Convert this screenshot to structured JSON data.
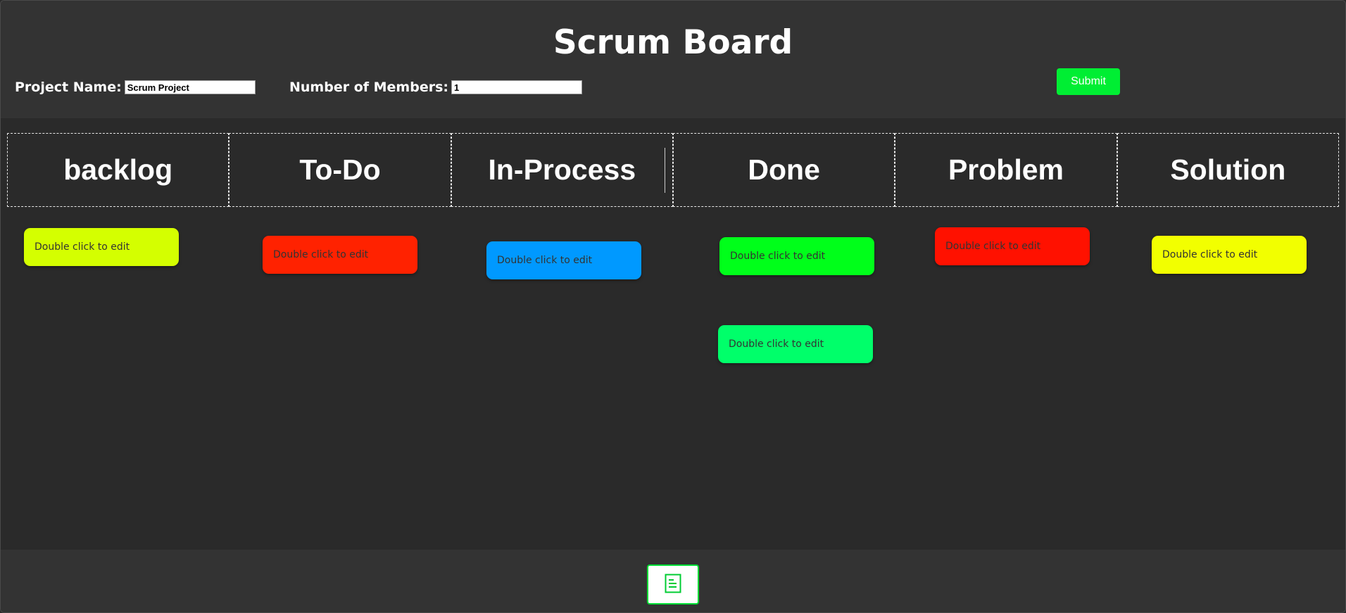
{
  "header": {
    "title": "Scrum Board",
    "project_name_label": "Project Name:",
    "project_name_value": "Scrum Project",
    "members_label": "Number of Members:",
    "members_value": "1",
    "submit_label": "Submit"
  },
  "columns": [
    "backlog",
    "To-Do",
    "In-Process",
    "Done",
    "Problem",
    "Solution"
  ],
  "notes": [
    {
      "column": "backlog",
      "text": "Double click to edit",
      "color": "#d4ff00"
    },
    {
      "column": "To-Do",
      "text": "Double click to edit",
      "color": "#ff2200"
    },
    {
      "column": "In-Process",
      "text": "Double click to edit",
      "color": "#0099ff"
    },
    {
      "column": "Done",
      "text": "Double click to edit",
      "color": "#00ff1a"
    },
    {
      "column": "Done",
      "text": "Double click to edit",
      "color": "#00ff6a"
    },
    {
      "column": "Problem",
      "text": "Double click to edit",
      "color": "#ff1100"
    },
    {
      "column": "Solution",
      "text": "Double click to edit",
      "color": "#f2ff00"
    }
  ],
  "footer": {
    "icon": "document-icon"
  },
  "colors": {
    "background": "#2a2a2a",
    "header_background": "#333333",
    "accent": "#00ee33"
  }
}
